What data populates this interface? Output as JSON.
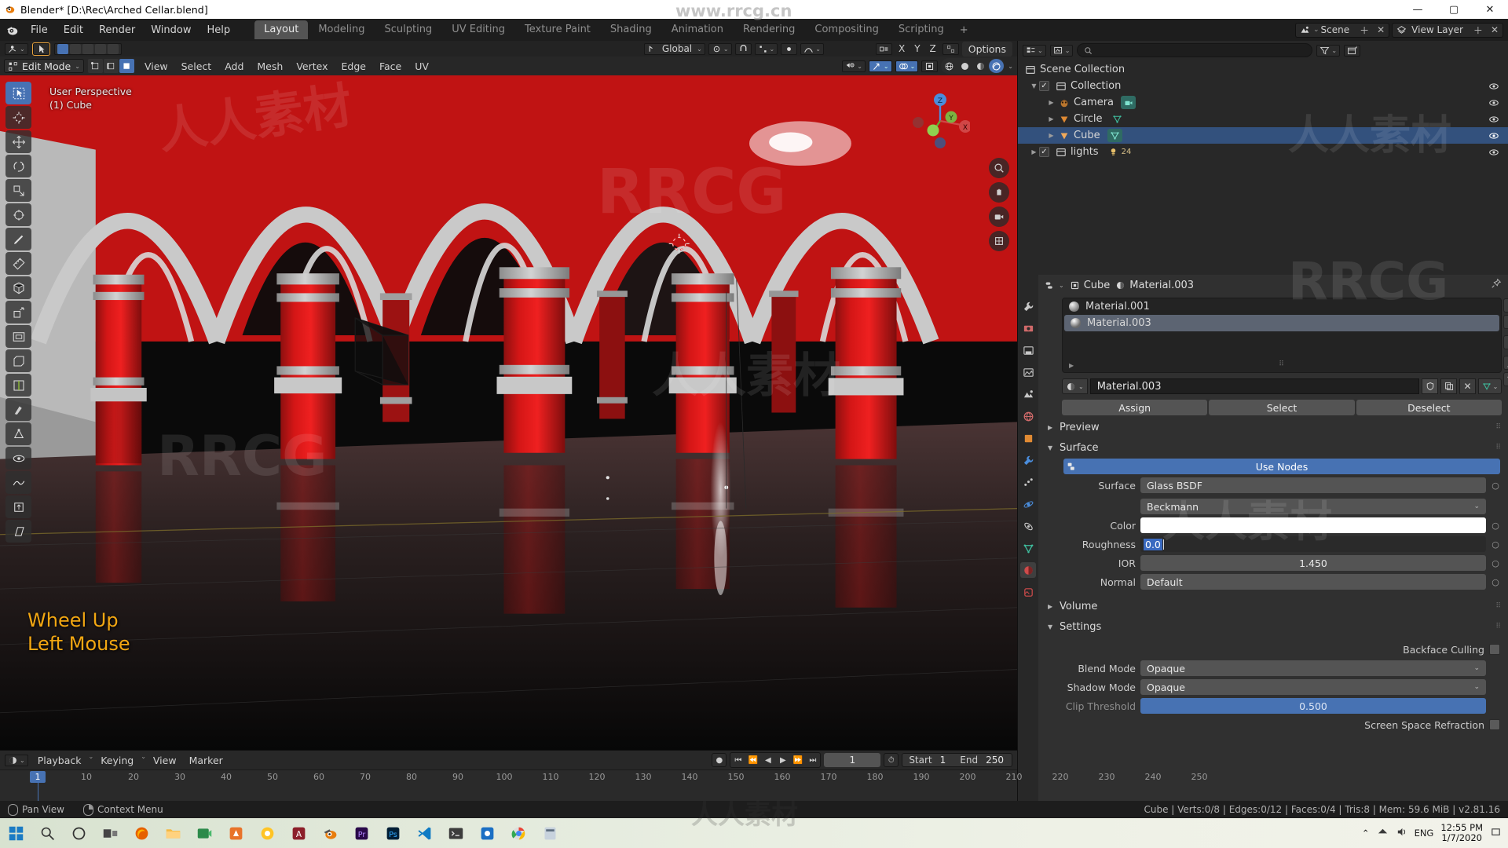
{
  "window": {
    "title": "Blender* [D:\\Rec\\Arched Cellar.blend]",
    "minimize": "—",
    "maximize": "▢",
    "close": "✕"
  },
  "topbar": {
    "menus": [
      "File",
      "Edit",
      "Render",
      "Window",
      "Help"
    ],
    "workspace_tabs": [
      "Layout",
      "Modeling",
      "Sculpting",
      "UV Editing",
      "Texture Paint",
      "Shading",
      "Animation",
      "Rendering",
      "Compositing",
      "Scripting"
    ],
    "active_workspace": "Layout",
    "add_tab": "+",
    "scene_label": "Scene",
    "view_layer_label": "View Layer"
  },
  "viewport": {
    "tool_header": {
      "options_label": "Options",
      "axis_x": "X",
      "axis_y": "Y",
      "axis_z": "Z"
    },
    "mode": "Edit Mode",
    "menus": [
      "View",
      "Select",
      "Add",
      "Mesh",
      "Vertex",
      "Edge",
      "Face",
      "UV"
    ],
    "transform_orientation": "Global",
    "overlay_line1": "User Perspective",
    "overlay_line2": "(1) Cube",
    "operator_line1": "Wheel Up",
    "operator_line2": "Left Mouse",
    "gizmo_axes": {
      "x": "X",
      "y": "Y",
      "z": "Z"
    }
  },
  "timeline": {
    "menus": [
      "Playback",
      "Keying",
      "View",
      "Marker"
    ],
    "current_frame": "1",
    "start_label": "Start",
    "start_value": "1",
    "end_label": "End",
    "end_value": "250",
    "ticks": [
      "1",
      "10",
      "20",
      "30",
      "40",
      "50",
      "60",
      "70",
      "80",
      "90",
      "100",
      "110",
      "120",
      "130",
      "140",
      "150",
      "160",
      "170",
      "180",
      "190",
      "200",
      "210",
      "220",
      "230",
      "240",
      "250"
    ]
  },
  "outliner": {
    "search_placeholder": "",
    "rows": [
      {
        "label": "Scene Collection",
        "indent": 0,
        "icon": "collection-icon",
        "selected": false,
        "has_check": false,
        "has_disclosure": false,
        "has_eye": false
      },
      {
        "label": "Collection",
        "indent": 1,
        "icon": "collection-icon",
        "selected": false,
        "has_check": true,
        "has_disclosure": true,
        "has_eye": true
      },
      {
        "label": "Camera",
        "indent": 2,
        "icon": "camera-icon",
        "selected": false,
        "has_check": false,
        "has_disclosure": true,
        "has_eye": true,
        "data_icon": "camera-data-icon"
      },
      {
        "label": "Circle",
        "indent": 2,
        "icon": "mesh-object-icon",
        "selected": false,
        "has_check": false,
        "has_disclosure": true,
        "has_eye": true,
        "data_icon": "mesh-data-icon"
      },
      {
        "label": "Cube",
        "indent": 2,
        "icon": "mesh-object-icon",
        "selected": true,
        "has_check": false,
        "has_disclosure": true,
        "has_eye": true,
        "data_icon": "mesh-data-icon"
      },
      {
        "label": "lights",
        "indent": 1,
        "icon": "collection-icon",
        "selected": false,
        "has_check": true,
        "has_disclosure": true,
        "has_eye": true,
        "count": "24"
      }
    ]
  },
  "properties": {
    "breadcrumb_object": "Cube",
    "breadcrumb_material": "Material.003",
    "material_slots": [
      {
        "name": "Material.001",
        "selected": false
      },
      {
        "name": "Material.003",
        "selected": true
      }
    ],
    "slot_buttons": [
      "+",
      "–",
      "⌄",
      "▲",
      "▼"
    ],
    "material_id_name": "Material.003",
    "id_buttons": [
      "shield",
      "copy",
      "x"
    ],
    "assign_row": [
      "Assign",
      "Select",
      "Deselect"
    ],
    "panels": {
      "preview": "Preview",
      "surface": "Surface",
      "volume": "Volume",
      "settings": "Settings"
    },
    "use_nodes": "Use Nodes",
    "surface_label": "Surface",
    "surface_value": "Glass BSDF",
    "distribution_value": "Beckmann",
    "color_label": "Color",
    "color_value": "#FFFFFF",
    "roughness_label": "Roughness",
    "roughness_value": "0.0",
    "ior_label": "IOR",
    "ior_value": "1.450",
    "normal_label": "Normal",
    "normal_value": "Default",
    "backface_culling_label": "Backface Culling",
    "blend_mode_label": "Blend Mode",
    "blend_mode_value": "Opaque",
    "shadow_mode_label": "Shadow Mode",
    "shadow_mode_value": "Opaque",
    "clip_threshold_label": "Clip Threshold",
    "clip_threshold_value": "0.500",
    "ssr_label": "Screen Space Refraction"
  },
  "statusbar": {
    "pan_view": "Pan View",
    "context_menu": "Context Menu",
    "stats": "Cube | Verts:0/8 | Edges:0/12 | Faces:0/4 | Tris:8 | Mem: 59.6 MiB | v2.81.16"
  },
  "taskbar": {
    "language": "ENG",
    "time": "12:55 PM",
    "date": "1/7/2020"
  },
  "watermarks": {
    "top": "www.rrcg.cn",
    "brand": "RRCG",
    "cn": "人人素材"
  },
  "colors": {
    "accent_blue": "#4772b3",
    "selection_blue": "#33517d",
    "operator_orange": "#f3a712",
    "panel_bg": "#303030"
  }
}
